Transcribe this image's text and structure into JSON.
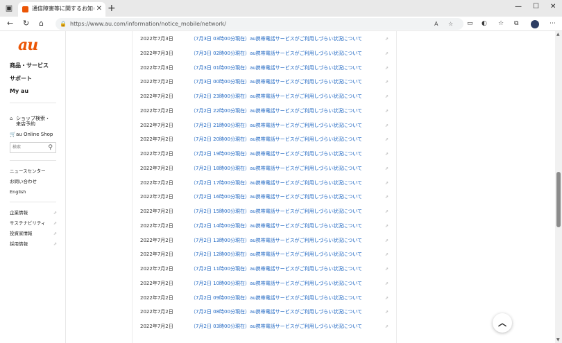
{
  "browser": {
    "tab_title": "通信障害等に関するお知らせ｜スマ",
    "tab_close": "✕",
    "new_tab": "+",
    "url": "https://www.au.com/information/notice_mobile/network/",
    "window": {
      "minimize": "—",
      "maximize": "☐",
      "close": "✕"
    }
  },
  "sidebar": {
    "logo": "au",
    "nav_main": [
      "商品・サービス",
      "サポート",
      "My au"
    ],
    "shop_search_line1": "ショップ検索・",
    "shop_search_line2": "来店予約",
    "online_shop": "au Online Shop",
    "search_placeholder": "検索",
    "links": [
      "ニュースセンター",
      "お問い合わせ",
      "English"
    ],
    "corporate_links": [
      "企業情報",
      "サステナビリティ",
      "投資家情報",
      "採用情報"
    ]
  },
  "notices": [
    {
      "date": "2022年7月3日",
      "title": "（7月3日 03時00分現在）au携帯電話サービスがご利用しづらい状況について"
    },
    {
      "date": "2022年7月3日",
      "title": "（7月3日 02時00分現在）au携帯電話サービスがご利用しづらい状況について"
    },
    {
      "date": "2022年7月3日",
      "title": "（7月3日 01時00分現在）au携帯電話サービスがご利用しづらい状況について"
    },
    {
      "date": "2022年7月2日",
      "title": "（7月3日 00時00分現在）au携帯電話サービスがご利用しづらい状況について"
    },
    {
      "date": "2022年7月2日",
      "title": "（7月2日 23時00分現在）au携帯電話サービスがご利用しづらい状況について"
    },
    {
      "date": "2022年7月2日",
      "title": "（7月2日 22時00分現在）au携帯電話サービスがご利用しづらい状況について"
    },
    {
      "date": "2022年7月2日",
      "title": "（7月2日 21時00分現在）au携帯電話サービスがご利用しづらい状況について"
    },
    {
      "date": "2022年7月2日",
      "title": "（7月2日 20時00分現在）au携帯電話サービスがご利用しづらい状況について"
    },
    {
      "date": "2022年7月2日",
      "title": "（7月2日 19時00分現在）au携帯電話サービスがご利用しづらい状況について"
    },
    {
      "date": "2022年7月2日",
      "title": "（7月2日 18時00分現在）au携帯電話サービスがご利用しづらい状況について"
    },
    {
      "date": "2022年7月2日",
      "title": "（7月2日 17時00分現在）au携帯電話サービスがご利用しづらい状況について"
    },
    {
      "date": "2022年7月2日",
      "title": "（7月2日 16時00分現在）au携帯電話サービスがご利用しづらい状況について"
    },
    {
      "date": "2022年7月2日",
      "title": "（7月2日 15時00分現在）au携帯電話サービスがご利用しづらい状況について"
    },
    {
      "date": "2022年7月2日",
      "title": "（7月2日 14時00分現在）au携帯電話サービスがご利用しづらい状況について"
    },
    {
      "date": "2022年7月2日",
      "title": "（7月2日 13時00分現在）au携帯電話サービスがご利用しづらい状況について"
    },
    {
      "date": "2022年7月2日",
      "title": "（7月2日 12時00分現在）au携帯電話サービスがご利用しづらい状況について"
    },
    {
      "date": "2022年7月2日",
      "title": "（7月2日 11時00分現在）au携帯電話サービスがご利用しづらい状況について"
    },
    {
      "date": "2022年7月2日",
      "title": "（7月2日 10時00分現在）au携帯電話サービスがご利用しづらい状況について"
    },
    {
      "date": "2022年7月2日",
      "title": "（7月2日 09時00分現在）au携帯電話サービスがご利用しづらい状況について"
    },
    {
      "date": "2022年7月2日",
      "title": "（7月2日 08時00分現在）au携帯電話サービスがご利用しづらい状況について"
    },
    {
      "date": "2022年7月2日",
      "title": "（7月2日 03時00分現在）au携帯電話サービスがご利用しづらい状況について"
    }
  ],
  "colors": {
    "brand": "#eb5505",
    "link": "#1e66c2"
  },
  "scroll_position": 0.55
}
